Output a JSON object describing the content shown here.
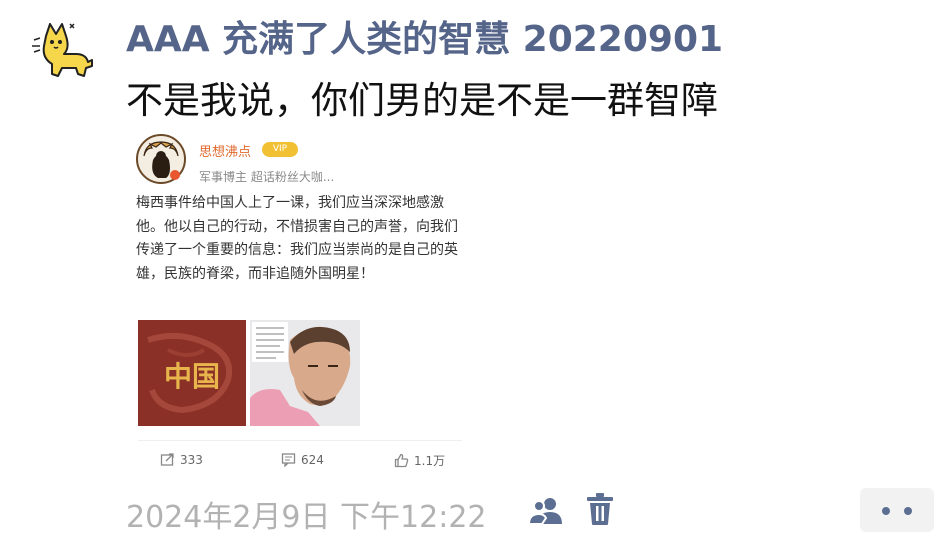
{
  "post": {
    "title": "AAA 充满了人类的智慧 20220901",
    "body": "不是我说，你们男的是不是一群智障"
  },
  "embedded": {
    "username": "思想沸点",
    "badge": "VIP",
    "meta": "军事博主 超话粉丝大咖...",
    "text": "梅西事件给中国人上了一课，我们应当深深地感激他。他以自己的行动，不惜损害自己的声誉，向我们传递了一个重要的信息：我们应当崇尚的是自己的英雄，民族的脊梁，而非追随外国明星！",
    "image_left_text": "中国",
    "stats": {
      "reposts": "333",
      "comments": "624",
      "likes": "1.1万"
    }
  },
  "footer": {
    "timestamp": "2024年2月9日 下午12:22"
  },
  "colors": {
    "title": "#55658a",
    "timestamp": "#b2b2b2",
    "accent_icon": "#5c6f92"
  }
}
